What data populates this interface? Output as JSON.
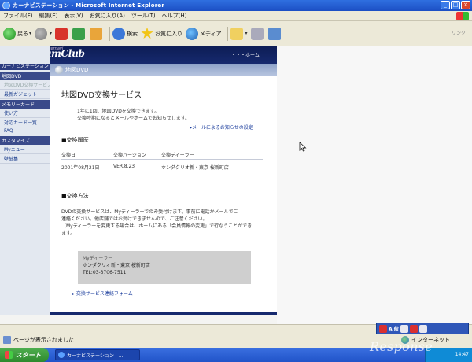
{
  "window": {
    "title": "カーナビステーション - Microsoft Internet Explorer"
  },
  "menu": [
    "ファイル(F)",
    "編集(E)",
    "表示(V)",
    "お気に入り(A)",
    "ツール(T)",
    "ヘルプ(H)"
  ],
  "toolbar": {
    "back_label": "戻る",
    "search_label": "検索",
    "favorites_label": "お気に入り",
    "media_label": "メディア",
    "links_label": "リンク"
  },
  "header": {
    "brand_small": "internavi",
    "brand": "PremiumClub",
    "home_link": "・・・ホーム"
  },
  "sidebar": {
    "category": "カーナビステーション",
    "items": [
      {
        "label": "地図DVD",
        "kind": "head"
      },
      {
        "label": "地図DVD交換サービス",
        "kind": "dim"
      },
      {
        "label": "最新ガジェット",
        "kind": "link"
      },
      {
        "label": "メモリーカード",
        "kind": "head"
      },
      {
        "label": "使い方",
        "kind": "link"
      },
      {
        "label": "対応カード一覧",
        "kind": "link"
      },
      {
        "label": "FAQ",
        "kind": "link"
      },
      {
        "label": "カスタマイズ",
        "kind": "head"
      },
      {
        "label": "Myニュー",
        "kind": "link"
      },
      {
        "label": "壁紙集",
        "kind": "link"
      }
    ]
  },
  "content": {
    "section_label": "地図DVD",
    "title": "地図DVD交換サービス",
    "intro_lines": [
      "1年に1回、地図DVDを交換できます。",
      "交換時期になるとメールやホームでお知らせします。"
    ],
    "mail_setting_link": "▸メールによるお知らせの設定",
    "history_heading": "■交換履歴",
    "history_columns": [
      "交換日",
      "交換バージョン",
      "交換ディーラー"
    ],
    "history_rows": [
      [
        "2001年08月21日",
        "VER.8.23",
        "ホンダクリオ新・東京 桜新町店"
      ]
    ],
    "method_heading": "■交換方法",
    "method_lines": [
      "DVDの交換サービスは、Myディーラーでのみ受付けます。事前に電話かメールでご",
      "連絡ください。他店舗ではお受けできませんので、ご注意ください。",
      "（Myディーラーを変更する場合は、ホームにある「会員情報の変更」で行なうことができ",
      "ます。"
    ],
    "dealer_label": "Myディーラー",
    "dealer_name": "ホンダクリオ新・東京 桜新町店",
    "dealer_tel": "TEL:03-3706-7511",
    "form_link": "▸ 交換サービス連絡フォーム"
  },
  "statusbar": {
    "status_text": "ページが表示されました",
    "zone_text": "インターネット"
  },
  "ime": {
    "mode_label": "A 般"
  },
  "taskbar": {
    "start_label": "スタート",
    "task_label": "カーナビステーション - ...",
    "clock": "14:47"
  },
  "watermark": "Response"
}
